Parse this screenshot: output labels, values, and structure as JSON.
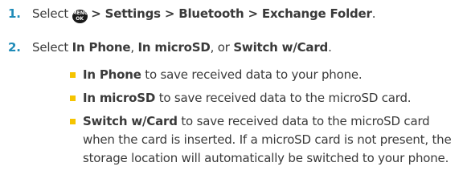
{
  "step1": {
    "number": "1.",
    "select": "Select",
    "key_top": "MENU",
    "key_bottom": "OK",
    "path": "> Settings > Bluetooth > Exchange Folder",
    "period": "."
  },
  "step2": {
    "number": "2.",
    "select": "Select",
    "opt1": "In Phone",
    "sep1": ",",
    "opt2": "In microSD",
    "sep2": ", or",
    "opt3": "Switch w/Card",
    "period": "."
  },
  "bullets": [
    {
      "term": "In Phone",
      "text": "to save received data to your phone."
    },
    {
      "term": "In microSD",
      "text": "to save received data to the microSD card."
    },
    {
      "term": "Switch w/Card",
      "text": "to save received data to the microSD card when the card is inserted. If a microSD card is not present, the storage location will automatically be switched to your phone."
    }
  ],
  "colors": {
    "step_number": "#1f8bb8",
    "bullet_square": "#f5c400",
    "text": "#3a3a3a"
  }
}
